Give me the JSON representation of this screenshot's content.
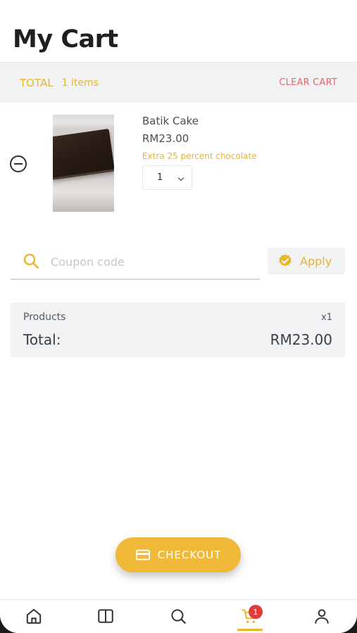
{
  "page": {
    "title": "My Cart"
  },
  "total_bar": {
    "label": "TOTAL",
    "count": "1 items",
    "clear_label": "CLEAR CART"
  },
  "cart_items": [
    {
      "name": "Batik Cake",
      "price": "RM23.00",
      "note": "Extra 25 percent chocolate",
      "quantity": "1"
    }
  ],
  "coupon": {
    "placeholder": "Coupon code",
    "apply_label": "Apply"
  },
  "summary": {
    "products_label": "Products",
    "products_count": "x1",
    "total_label": "Total:",
    "total_value": "RM23.00"
  },
  "checkout": {
    "label": "CHECKOUT"
  },
  "bottom_nav": {
    "items": [
      "home-icon",
      "book-icon",
      "search-icon",
      "cart-icon",
      "user-icon"
    ],
    "active": "cart-icon",
    "cart_badge": "1"
  },
  "colors": {
    "accent": "#eab52a",
    "button": "#f0b93a",
    "danger": "#e0686d",
    "badge": "#e23b3b",
    "panel": "#f1f2f4"
  }
}
